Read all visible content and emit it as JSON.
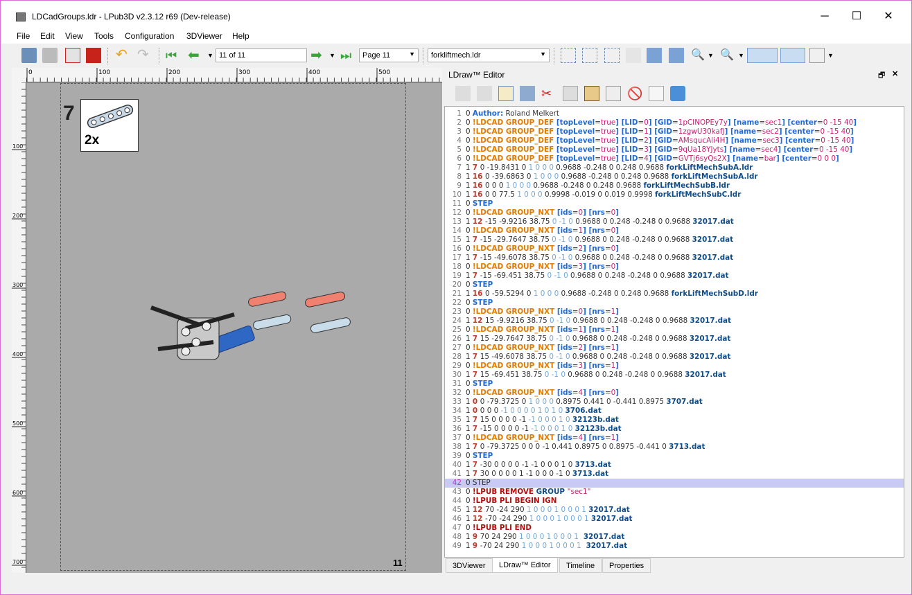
{
  "window": {
    "title": "LDCadGroups.ldr - LPub3D v2.3.12 r69 (Dev-release)",
    "minimize": "─",
    "maximize": "☐",
    "close": "✕"
  },
  "menu": [
    "File",
    "Edit",
    "View",
    "Tools",
    "Configuration",
    "3DViewer",
    "Help"
  ],
  "toolbar": {
    "page_input": "11 of 11",
    "page_select": "Page 11",
    "model_select": "forkliftmech.ldr"
  },
  "ruler": {
    "h_ticks": [
      "0",
      "100",
      "200",
      "300",
      "400",
      "500"
    ],
    "v_ticks": [
      "100",
      "200",
      "300",
      "400",
      "500",
      "600",
      "700"
    ]
  },
  "page": {
    "step_number": "7",
    "pli_quantity": "2x",
    "page_number": "11"
  },
  "editor": {
    "title": "LDraw™ Editor",
    "float": "🗗",
    "close": "✕"
  },
  "tabs": [
    "3DViewer",
    "LDraw™ Editor",
    "Timeline",
    "Properties"
  ],
  "lines": [
    [
      [
        "o",
        "0 "
      ],
      [
        "m",
        "Author:"
      ],
      [
        "o",
        " Roland Melkert"
      ]
    ],
    [
      [
        "o",
        "0 "
      ],
      [
        "k",
        "!LDCAD GROUP_DEF "
      ],
      [
        "m",
        "["
      ],
      [
        "m",
        "topLevel"
      ],
      [
        "o",
        "="
      ],
      [
        "p",
        "true"
      ],
      [
        "m",
        "] [LID"
      ],
      [
        "o",
        "="
      ],
      [
        "p",
        "0"
      ],
      [
        "m",
        "] [GID"
      ],
      [
        "o",
        "="
      ],
      [
        "p",
        "1pCINOPEy7y"
      ],
      [
        "m",
        "] [name"
      ],
      [
        "o",
        "="
      ],
      [
        "p",
        "sec1"
      ],
      [
        "m",
        "] [center"
      ],
      [
        "o",
        "="
      ],
      [
        "p",
        "0 -15 40"
      ],
      [
        "m",
        "]"
      ]
    ],
    [
      [
        "o",
        "0 "
      ],
      [
        "k",
        "!LDCAD GROUP_DEF "
      ],
      [
        "m",
        "["
      ],
      [
        "m",
        "topLevel"
      ],
      [
        "o",
        "="
      ],
      [
        "p",
        "true"
      ],
      [
        "m",
        "] [LID"
      ],
      [
        "o",
        "="
      ],
      [
        "p",
        "1"
      ],
      [
        "m",
        "] [GID"
      ],
      [
        "o",
        "="
      ],
      [
        "p",
        "1zgwU30kafJ"
      ],
      [
        "m",
        "] [name"
      ],
      [
        "o",
        "="
      ],
      [
        "p",
        "sec2"
      ],
      [
        "m",
        "] [center"
      ],
      [
        "o",
        "="
      ],
      [
        "p",
        "0 -15 40"
      ],
      [
        "m",
        "]"
      ]
    ],
    [
      [
        "o",
        "0 "
      ],
      [
        "k",
        "!LDCAD GROUP_DEF "
      ],
      [
        "m",
        "["
      ],
      [
        "m",
        "topLevel"
      ],
      [
        "o",
        "="
      ],
      [
        "p",
        "true"
      ],
      [
        "m",
        "] [LID"
      ],
      [
        "o",
        "="
      ],
      [
        "p",
        "2"
      ],
      [
        "m",
        "] [GID"
      ],
      [
        "o",
        "="
      ],
      [
        "p",
        "AMsqucAli4H"
      ],
      [
        "m",
        "] [name"
      ],
      [
        "o",
        "="
      ],
      [
        "p",
        "sec3"
      ],
      [
        "m",
        "] [center"
      ],
      [
        "o",
        "="
      ],
      [
        "p",
        "0 -15 40"
      ],
      [
        "m",
        "]"
      ]
    ],
    [
      [
        "o",
        "0 "
      ],
      [
        "k",
        "!LDCAD GROUP_DEF "
      ],
      [
        "m",
        "["
      ],
      [
        "m",
        "topLevel"
      ],
      [
        "o",
        "="
      ],
      [
        "p",
        "true"
      ],
      [
        "m",
        "] [LID"
      ],
      [
        "o",
        "="
      ],
      [
        "p",
        "3"
      ],
      [
        "m",
        "] [GID"
      ],
      [
        "o",
        "="
      ],
      [
        "p",
        "9qUa18YJyts"
      ],
      [
        "m",
        "] [name"
      ],
      [
        "o",
        "="
      ],
      [
        "p",
        "sec4"
      ],
      [
        "m",
        "] [center"
      ],
      [
        "o",
        "="
      ],
      [
        "p",
        "0 -15 40"
      ],
      [
        "m",
        "]"
      ]
    ],
    [
      [
        "o",
        "0 "
      ],
      [
        "k",
        "!LDCAD GROUP_DEF "
      ],
      [
        "m",
        "["
      ],
      [
        "m",
        "topLevel"
      ],
      [
        "o",
        "="
      ],
      [
        "p",
        "true"
      ],
      [
        "m",
        "] [LID"
      ],
      [
        "o",
        "="
      ],
      [
        "p",
        "4"
      ],
      [
        "m",
        "] [GID"
      ],
      [
        "o",
        "="
      ],
      [
        "p",
        "GVTj6syQs2X"
      ],
      [
        "m",
        "] [name"
      ],
      [
        "o",
        "="
      ],
      [
        "p",
        "bar"
      ],
      [
        "m",
        "] [center"
      ],
      [
        "o",
        "="
      ],
      [
        "p",
        "0 0 0"
      ],
      [
        "m",
        "]"
      ]
    ],
    [
      [
        "o",
        "1 "
      ],
      [
        "c",
        "7 "
      ],
      [
        "o",
        "0 -19.8431 0 "
      ],
      [
        "g",
        "1 0 0 0 "
      ],
      [
        "o",
        "0.9688 -0.248 0 0.248 0.9688 "
      ],
      [
        "d",
        "forkLiftMechSubA.ldr"
      ]
    ],
    [
      [
        "o",
        "1 "
      ],
      [
        "c",
        "16 "
      ],
      [
        "o",
        "0 -39.6863 0 "
      ],
      [
        "g",
        "1 0 0 0 "
      ],
      [
        "o",
        "0.9688 -0.248 0 0.248 0.9688 "
      ],
      [
        "d",
        "forkLiftMechSubA.ldr"
      ]
    ],
    [
      [
        "o",
        "1 "
      ],
      [
        "c",
        "16 "
      ],
      [
        "o",
        "0 0 0 "
      ],
      [
        "g",
        "1 0 0 0 "
      ],
      [
        "o",
        "0.9688 -0.248 0 0.248 0.9688 "
      ],
      [
        "d",
        "forkLiftMechSubB.ldr"
      ]
    ],
    [
      [
        "o",
        "1 "
      ],
      [
        "c",
        "16 "
      ],
      [
        "o",
        "0 0 77.5 "
      ],
      [
        "g",
        "1 0 0 0 "
      ],
      [
        "o",
        "0.9998 -0.019 0 0.019 0.9998 "
      ],
      [
        "d",
        "forkLiftMechSubC.ldr"
      ]
    ],
    [
      [
        "o",
        "0 "
      ],
      [
        "m",
        "STEP"
      ]
    ],
    [
      [
        "o",
        "0 "
      ],
      [
        "k",
        "!LDCAD GROUP_NXT "
      ],
      [
        "m",
        "[ids"
      ],
      [
        "o",
        "="
      ],
      [
        "p",
        "0"
      ],
      [
        "m",
        "] [nrs"
      ],
      [
        "o",
        "="
      ],
      [
        "p",
        "0"
      ],
      [
        "m",
        "]"
      ]
    ],
    [
      [
        "o",
        "1 "
      ],
      [
        "c",
        "12 "
      ],
      [
        "o",
        "-15 -9.9216 38.75 "
      ],
      [
        "g",
        "0 -1 0 "
      ],
      [
        "o",
        "0.9688 0 0.248 -0.248 0 0.9688 "
      ],
      [
        "d",
        "32017.dat"
      ]
    ],
    [
      [
        "o",
        "0 "
      ],
      [
        "k",
        "!LDCAD GROUP_NXT "
      ],
      [
        "m",
        "[ids"
      ],
      [
        "o",
        "="
      ],
      [
        "p",
        "1"
      ],
      [
        "m",
        "] [nrs"
      ],
      [
        "o",
        "="
      ],
      [
        "p",
        "0"
      ],
      [
        "m",
        "]"
      ]
    ],
    [
      [
        "o",
        "1 "
      ],
      [
        "c",
        "7 "
      ],
      [
        "o",
        "-15 -29.7647 38.75 "
      ],
      [
        "g",
        "0 -1 0 "
      ],
      [
        "o",
        "0.9688 0 0.248 -0.248 0 0.9688 "
      ],
      [
        "d",
        "32017.dat"
      ]
    ],
    [
      [
        "o",
        "0 "
      ],
      [
        "k",
        "!LDCAD GROUP_NXT "
      ],
      [
        "m",
        "[ids"
      ],
      [
        "o",
        "="
      ],
      [
        "p",
        "2"
      ],
      [
        "m",
        "] [nrs"
      ],
      [
        "o",
        "="
      ],
      [
        "p",
        "0"
      ],
      [
        "m",
        "]"
      ]
    ],
    [
      [
        "o",
        "1 "
      ],
      [
        "c",
        "7 "
      ],
      [
        "o",
        "-15 -49.6078 38.75 "
      ],
      [
        "g",
        "0 -1 0 "
      ],
      [
        "o",
        "0.9688 0 0.248 -0.248 0 0.9688 "
      ],
      [
        "d",
        "32017.dat"
      ]
    ],
    [
      [
        "o",
        "0 "
      ],
      [
        "k",
        "!LDCAD GROUP_NXT "
      ],
      [
        "m",
        "[ids"
      ],
      [
        "o",
        "="
      ],
      [
        "p",
        "3"
      ],
      [
        "m",
        "] [nrs"
      ],
      [
        "o",
        "="
      ],
      [
        "p",
        "0"
      ],
      [
        "m",
        "]"
      ]
    ],
    [
      [
        "o",
        "1 "
      ],
      [
        "c",
        "7 "
      ],
      [
        "o",
        "-15 -69.451 38.75 "
      ],
      [
        "g",
        "0 -1 0 "
      ],
      [
        "o",
        "0.9688 0 0.248 -0.248 0 0.9688 "
      ],
      [
        "d",
        "32017.dat"
      ]
    ],
    [
      [
        "o",
        "0 "
      ],
      [
        "m",
        "STEP"
      ]
    ],
    [
      [
        "o",
        "1 "
      ],
      [
        "c",
        "16 "
      ],
      [
        "o",
        "0 -59.5294 0 "
      ],
      [
        "g",
        "1 0 0 0 "
      ],
      [
        "o",
        "0.9688 -0.248 0 0.248 0.9688 "
      ],
      [
        "d",
        "forkLiftMechSubD.ldr"
      ]
    ],
    [
      [
        "o",
        "0 "
      ],
      [
        "m",
        "STEP"
      ]
    ],
    [
      [
        "o",
        "0 "
      ],
      [
        "k",
        "!LDCAD GROUP_NXT "
      ],
      [
        "m",
        "[ids"
      ],
      [
        "o",
        "="
      ],
      [
        "p",
        "0"
      ],
      [
        "m",
        "] [nrs"
      ],
      [
        "o",
        "="
      ],
      [
        "p",
        "1"
      ],
      [
        "m",
        "]"
      ]
    ],
    [
      [
        "o",
        "1 "
      ],
      [
        "c",
        "12 "
      ],
      [
        "o",
        "15 -9.9216 38.75 "
      ],
      [
        "g",
        "0 -1 0 "
      ],
      [
        "o",
        "0.9688 0 0.248 -0.248 0 0.9688 "
      ],
      [
        "d",
        "32017.dat"
      ]
    ],
    [
      [
        "o",
        "0 "
      ],
      [
        "k",
        "!LDCAD GROUP_NXT "
      ],
      [
        "m",
        "[ids"
      ],
      [
        "o",
        "="
      ],
      [
        "p",
        "1"
      ],
      [
        "m",
        "] [nrs"
      ],
      [
        "o",
        "="
      ],
      [
        "p",
        "1"
      ],
      [
        "m",
        "]"
      ]
    ],
    [
      [
        "o",
        "1 "
      ],
      [
        "c",
        "7 "
      ],
      [
        "o",
        "15 -29.7647 38.75 "
      ],
      [
        "g",
        "0 -1 0 "
      ],
      [
        "o",
        "0.9688 0 0.248 -0.248 0 0.9688 "
      ],
      [
        "d",
        "32017.dat"
      ]
    ],
    [
      [
        "o",
        "0 "
      ],
      [
        "k",
        "!LDCAD GROUP_NXT "
      ],
      [
        "m",
        "[ids"
      ],
      [
        "o",
        "="
      ],
      [
        "p",
        "2"
      ],
      [
        "m",
        "] [nrs"
      ],
      [
        "o",
        "="
      ],
      [
        "p",
        "1"
      ],
      [
        "m",
        "]"
      ]
    ],
    [
      [
        "o",
        "1 "
      ],
      [
        "c",
        "7 "
      ],
      [
        "o",
        "15 -49.6078 38.75 "
      ],
      [
        "g",
        "0 -1 0 "
      ],
      [
        "o",
        "0.9688 0 0.248 -0.248 0 0.9688 "
      ],
      [
        "d",
        "32017.dat"
      ]
    ],
    [
      [
        "o",
        "0 "
      ],
      [
        "k",
        "!LDCAD GROUP_NXT "
      ],
      [
        "m",
        "[ids"
      ],
      [
        "o",
        "="
      ],
      [
        "p",
        "3"
      ],
      [
        "m",
        "] [nrs"
      ],
      [
        "o",
        "="
      ],
      [
        "p",
        "1"
      ],
      [
        "m",
        "]"
      ]
    ],
    [
      [
        "o",
        "1 "
      ],
      [
        "c",
        "7 "
      ],
      [
        "o",
        "15 -69.451 38.75 "
      ],
      [
        "g",
        "0 -1 0 "
      ],
      [
        "o",
        "0.9688 0 0.248 -0.248 0 0.9688 "
      ],
      [
        "d",
        "32017.dat"
      ]
    ],
    [
      [
        "o",
        "0 "
      ],
      [
        "m",
        "STEP"
      ]
    ],
    [
      [
        "o",
        "0 "
      ],
      [
        "k",
        "!LDCAD GROUP_NXT "
      ],
      [
        "m",
        "[ids"
      ],
      [
        "o",
        "="
      ],
      [
        "p",
        "4"
      ],
      [
        "m",
        "] [nrs"
      ],
      [
        "o",
        "="
      ],
      [
        "p",
        "0"
      ],
      [
        "m",
        "]"
      ]
    ],
    [
      [
        "o",
        "1 "
      ],
      [
        "c",
        "0 "
      ],
      [
        "o",
        "0 -79.3725 0 "
      ],
      [
        "g",
        "1 0 0 0 "
      ],
      [
        "o",
        "0.8975 0.441 0 -0.441 0.8975 "
      ],
      [
        "d",
        "3707.dat"
      ]
    ],
    [
      [
        "o",
        "1 "
      ],
      [
        "c",
        "0 "
      ],
      [
        "o",
        "0 0 0 "
      ],
      [
        "g",
        "-1 0 0 0 0 1 0 1 0 "
      ],
      [
        "d",
        "3706.dat"
      ]
    ],
    [
      [
        "o",
        "1 "
      ],
      [
        "c",
        "7 "
      ],
      [
        "o",
        "15 0 0 0 0 -1 "
      ],
      [
        "g",
        "-1 0 0 0 1 0 "
      ],
      [
        "d",
        "32123b.dat"
      ]
    ],
    [
      [
        "o",
        "1 "
      ],
      [
        "c",
        "7 "
      ],
      [
        "o",
        "-15 0 0 0 0 -1 "
      ],
      [
        "g",
        "-1 0 0 0 1 0 "
      ],
      [
        "d",
        "32123b.dat"
      ]
    ],
    [
      [
        "o",
        "0 "
      ],
      [
        "k",
        "!LDCAD GROUP_NXT "
      ],
      [
        "m",
        "[ids"
      ],
      [
        "o",
        "="
      ],
      [
        "p",
        "4"
      ],
      [
        "m",
        "] [nrs"
      ],
      [
        "o",
        "="
      ],
      [
        "p",
        "1"
      ],
      [
        "m",
        "]"
      ]
    ],
    [
      [
        "o",
        "1 "
      ],
      [
        "c",
        "7 "
      ],
      [
        "o",
        "0 -79.3725 0 0 0 -1 0.441 0.8975 0 0.8975 -0.441 0 "
      ],
      [
        "d",
        "3713.dat"
      ]
    ],
    [
      [
        "o",
        "0 "
      ],
      [
        "m",
        "STEP"
      ]
    ],
    [
      [
        "o",
        "1 "
      ],
      [
        "c",
        "7 "
      ],
      [
        "o",
        "-30 0 0 0 0 -1 -1 0 0 0 1 0 "
      ],
      [
        "d",
        "3713.dat"
      ]
    ],
    [
      [
        "o",
        "1 "
      ],
      [
        "c",
        "7 "
      ],
      [
        "o",
        "30 0 0 0 0 1 -1 0 0 0 -1 0 "
      ],
      [
        "d",
        "3713.dat"
      ]
    ],
    [
      [
        "o",
        "0 "
      ],
      [
        "o",
        "STEP"
      ]
    ],
    [
      [
        "o",
        "0 "
      ],
      [
        "r",
        "!LPUB "
      ],
      [
        "r",
        "REMOVE "
      ],
      [
        "d",
        "GROUP "
      ],
      [
        "p",
        "\"sec1\""
      ]
    ],
    [
      [
        "o",
        "0 "
      ],
      [
        "r",
        "!LPUB "
      ],
      [
        "r",
        "PLI BEGIN IGN"
      ]
    ],
    [
      [
        "o",
        "1 "
      ],
      [
        "c",
        "12 "
      ],
      [
        "o",
        "70 -24 290 "
      ],
      [
        "g",
        "1 0 0 0 1 0 0 0 1 "
      ],
      [
        "d",
        "32017.dat"
      ]
    ],
    [
      [
        "o",
        "1 "
      ],
      [
        "c",
        "12 "
      ],
      [
        "o",
        "-70 -24 290 "
      ],
      [
        "g",
        "1 0 0 0 1 0 0 0 1 "
      ],
      [
        "d",
        "32017.dat"
      ]
    ],
    [
      [
        "o",
        "0 "
      ],
      [
        "r",
        "!LPUB "
      ],
      [
        "r",
        "PLI END"
      ]
    ],
    [
      [
        "o",
        "1 "
      ],
      [
        "c",
        "9 "
      ],
      [
        "o",
        "70 24 290 "
      ],
      [
        "g",
        "1 0 0 0 1 0 0 0 1 "
      ],
      [
        "d",
        " 32017.dat"
      ]
    ],
    [
      [
        "o",
        "1 "
      ],
      [
        "c",
        "9 "
      ],
      [
        "o",
        "-70 24 290 "
      ],
      [
        "g",
        "1 0 0 0 1 0 0 0 1 "
      ],
      [
        "d",
        " 32017.dat"
      ]
    ]
  ],
  "current_line": 42
}
